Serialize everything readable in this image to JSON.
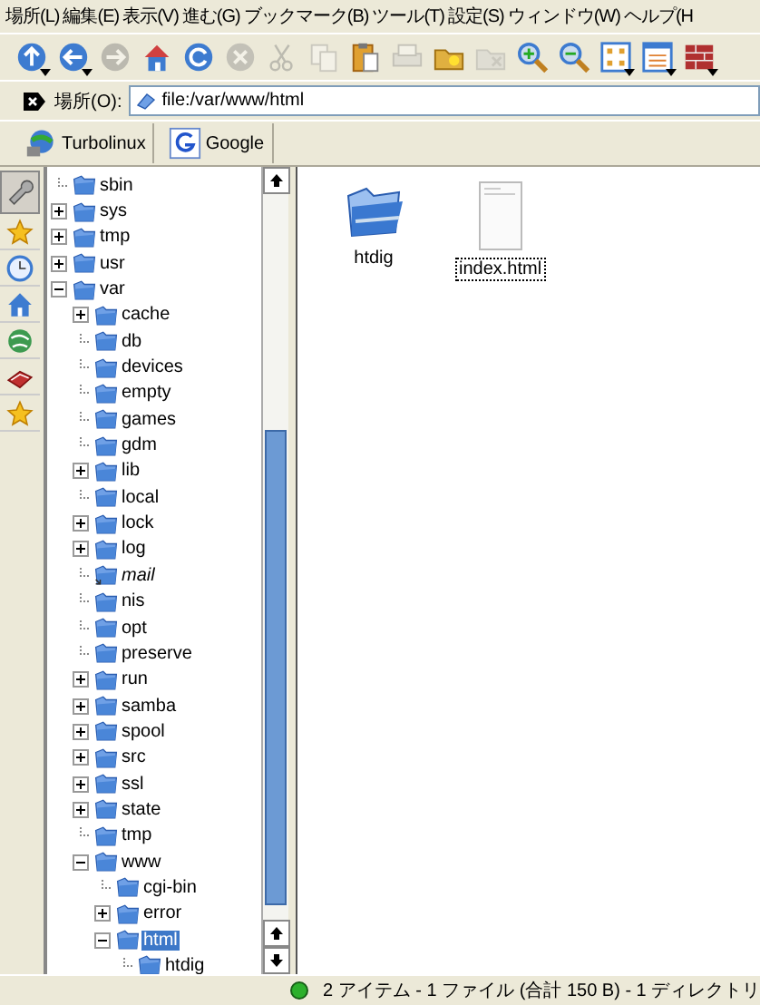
{
  "menu": [
    "場所(L)",
    "編集(E)",
    "表示(V)",
    "進む(G)",
    "ブックマーク(B)",
    "ツール(T)",
    "設定(S)",
    "ウィンドウ(W)",
    "ヘルプ(H"
  ],
  "toolbar": [
    {
      "kind": "up",
      "disabled": false,
      "dropdown": true
    },
    {
      "kind": "back",
      "disabled": false,
      "dropdown": true
    },
    {
      "kind": "forward",
      "disabled": true,
      "dropdown": false
    },
    {
      "kind": "home",
      "disabled": false,
      "dropdown": false
    },
    {
      "kind": "reload",
      "disabled": false,
      "dropdown": false
    },
    {
      "kind": "stop",
      "disabled": true,
      "dropdown": false
    },
    {
      "kind": "cut",
      "disabled": true,
      "dropdown": false
    },
    {
      "kind": "copy",
      "disabled": true,
      "dropdown": false
    },
    {
      "kind": "paste",
      "disabled": false,
      "dropdown": false
    },
    {
      "kind": "print",
      "disabled": true,
      "dropdown": false
    },
    {
      "kind": "newfolder",
      "disabled": false,
      "dropdown": false
    },
    {
      "kind": "trash",
      "disabled": true,
      "dropdown": false
    },
    {
      "kind": "zoomin",
      "disabled": false,
      "dropdown": false
    },
    {
      "kind": "zoomout",
      "disabled": false,
      "dropdown": false
    },
    {
      "kind": "iconview",
      "disabled": false,
      "dropdown": true
    },
    {
      "kind": "listview",
      "disabled": false,
      "dropdown": true
    },
    {
      "kind": "firewall",
      "disabled": false,
      "dropdown": true
    }
  ],
  "location": {
    "label": "場所(O):",
    "value": "file:/var/www/html"
  },
  "bookmarks": [
    {
      "kind": "globe",
      "label": "Turbolinux"
    },
    {
      "kind": "google",
      "label": "Google"
    }
  ],
  "sidebar_tabs": [
    {
      "kind": "wrench",
      "selected": true
    },
    {
      "kind": "star",
      "selected": false
    },
    {
      "kind": "clock",
      "selected": false
    },
    {
      "kind": "home",
      "selected": false
    },
    {
      "kind": "globe",
      "selected": false
    },
    {
      "kind": "book",
      "selected": false
    },
    {
      "kind": "star",
      "selected": false
    }
  ],
  "tree": [
    {
      "name": "sbin",
      "expandable": false,
      "kind": "folder",
      "selected": false
    },
    {
      "name": "sys",
      "expandable": true,
      "expanded": false,
      "kind": "folder",
      "selected": false
    },
    {
      "name": "tmp",
      "expandable": true,
      "expanded": false,
      "kind": "folder",
      "selected": false
    },
    {
      "name": "usr",
      "expandable": true,
      "expanded": false,
      "kind": "folder",
      "selected": false
    },
    {
      "name": "var",
      "expandable": true,
      "expanded": true,
      "kind": "folder",
      "selected": false,
      "children": [
        {
          "name": "cache",
          "expandable": true,
          "expanded": false,
          "kind": "folder",
          "selected": false
        },
        {
          "name": "db",
          "expandable": false,
          "kind": "folder",
          "selected": false
        },
        {
          "name": "devices",
          "expandable": false,
          "kind": "folder",
          "selected": false
        },
        {
          "name": "empty",
          "expandable": false,
          "kind": "folder",
          "selected": false
        },
        {
          "name": "games",
          "expandable": false,
          "kind": "folder",
          "selected": false
        },
        {
          "name": "gdm",
          "expandable": false,
          "kind": "folder",
          "selected": false
        },
        {
          "name": "lib",
          "expandable": true,
          "expanded": false,
          "kind": "folder",
          "selected": false
        },
        {
          "name": "local",
          "expandable": false,
          "kind": "folder",
          "selected": false
        },
        {
          "name": "lock",
          "expandable": true,
          "expanded": false,
          "kind": "folder",
          "selected": false
        },
        {
          "name": "log",
          "expandable": true,
          "expanded": false,
          "kind": "folder",
          "selected": false
        },
        {
          "name": "mail",
          "expandable": false,
          "kind": "symlink",
          "selected": false
        },
        {
          "name": "nis",
          "expandable": false,
          "kind": "folder",
          "selected": false
        },
        {
          "name": "opt",
          "expandable": false,
          "kind": "folder",
          "selected": false
        },
        {
          "name": "preserve",
          "expandable": false,
          "kind": "folder",
          "selected": false
        },
        {
          "name": "run",
          "expandable": true,
          "expanded": false,
          "kind": "folder",
          "selected": false
        },
        {
          "name": "samba",
          "expandable": true,
          "expanded": false,
          "kind": "folder",
          "selected": false
        },
        {
          "name": "spool",
          "expandable": true,
          "expanded": false,
          "kind": "folder",
          "selected": false
        },
        {
          "name": "src",
          "expandable": true,
          "expanded": false,
          "kind": "folder",
          "selected": false
        },
        {
          "name": "ssl",
          "expandable": true,
          "expanded": false,
          "kind": "folder",
          "selected": false
        },
        {
          "name": "state",
          "expandable": true,
          "expanded": false,
          "kind": "folder",
          "selected": false
        },
        {
          "name": "tmp",
          "expandable": false,
          "kind": "folder",
          "selected": false
        },
        {
          "name": "www",
          "expandable": true,
          "expanded": true,
          "kind": "folder",
          "selected": false,
          "children": [
            {
              "name": "cgi-bin",
              "expandable": false,
              "kind": "folder",
              "selected": false
            },
            {
              "name": "error",
              "expandable": true,
              "expanded": false,
              "kind": "folder",
              "selected": false
            },
            {
              "name": "html",
              "expandable": true,
              "expanded": true,
              "kind": "folder",
              "selected": true,
              "children": [
                {
                  "name": "htdig",
                  "expandable": false,
                  "kind": "folder",
                  "selected": false
                }
              ]
            }
          ]
        }
      ]
    }
  ],
  "files": [
    {
      "name": "htdig",
      "kind": "folder",
      "focused": false
    },
    {
      "name": "index.html",
      "kind": "file",
      "focused": true
    }
  ],
  "status": "2 アイテム - 1 ファイル (合計 150 B) - 1 ディレクトリ"
}
